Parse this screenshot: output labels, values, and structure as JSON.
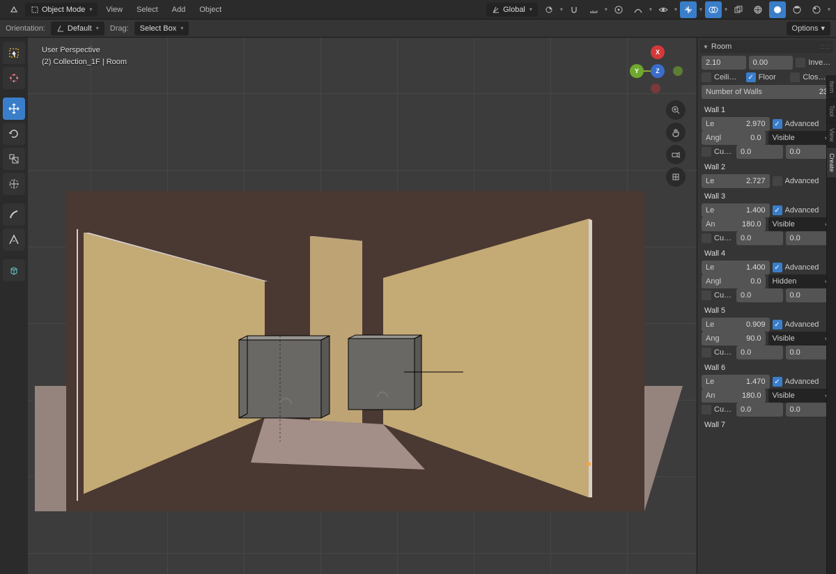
{
  "header": {
    "mode": "Object Mode",
    "menus": [
      "View",
      "Select",
      "Add",
      "Object"
    ],
    "transform_orientation": "Global"
  },
  "subheader": {
    "orientation_label": "Orientation:",
    "orientation_value": "Default",
    "drag_label": "Drag:",
    "drag_value": "Select Box",
    "options_label": "Options"
  },
  "viewport": {
    "line1": "User Perspective",
    "line2": "(2) Collection_1F | Room"
  },
  "right_tabs": [
    "Item",
    "Tool",
    "View",
    "Create"
  ],
  "room_panel": {
    "title": "Room",
    "field1_val": "2.10",
    "field2_val": "0.00",
    "inverse_label": "Inve…",
    "ceiling_label": "Ceili…",
    "floor_label": "Floor",
    "closed_label": "Clos…",
    "num_walls_label": "Number of Walls",
    "num_walls_val": "23"
  },
  "walls": [
    {
      "name": "Wall 1",
      "len_label": "Le",
      "len": "2.970",
      "advanced": true,
      "advanced_label": "Advanced",
      "angle_label": "Angl",
      "angle": "0.0",
      "visibility": "Visible",
      "curve_label": "Cur…",
      "curve_a": "0.0",
      "curve_b": "0.0"
    },
    {
      "name": "Wall 2",
      "len_label": "Le",
      "len": "2.727",
      "advanced": false,
      "advanced_label": "Advanced"
    },
    {
      "name": "Wall 3",
      "len_label": "Le",
      "len": "1.400",
      "advanced": true,
      "advanced_label": "Advanced",
      "angle_label": "An",
      "angle": "180.0",
      "visibility": "Visible",
      "curve_label": "Cur…",
      "curve_a": "0.0",
      "curve_b": "0.0"
    },
    {
      "name": "Wall 4",
      "len_label": "Le",
      "len": "1.400",
      "advanced": true,
      "advanced_label": "Advanced",
      "angle_label": "Angl",
      "angle": "0.0",
      "visibility": "Hidden",
      "curve_label": "Cur…",
      "curve_a": "0.0",
      "curve_b": "0.0"
    },
    {
      "name": "Wall 5",
      "len_label": "Le",
      "len": "0.909",
      "advanced": true,
      "advanced_label": "Advanced",
      "angle_label": "Ang",
      "angle": "90.0",
      "visibility": "Visible",
      "curve_label": "Cur…",
      "curve_a": "0.0",
      "curve_b": "0.0"
    },
    {
      "name": "Wall 6",
      "len_label": "Le",
      "len": "1.470",
      "advanced": true,
      "advanced_label": "Advanced",
      "angle_label": "An",
      "angle": "180.0",
      "visibility": "Visible",
      "curve_label": "Cur…",
      "curve_a": "0.0",
      "curve_b": "0.0"
    },
    {
      "name": "Wall 7"
    }
  ]
}
